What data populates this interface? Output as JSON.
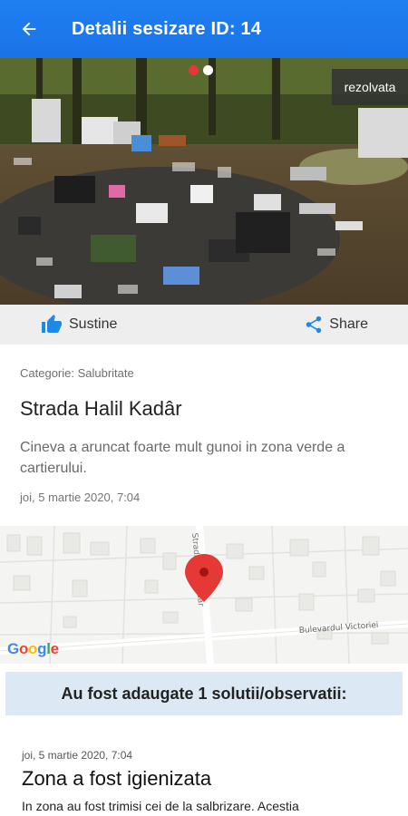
{
  "appbar": {
    "title": "Detalii sesizare ID: 14",
    "back_icon": "arrow-back-icon",
    "color": "#1a73e8"
  },
  "hero": {
    "status": "rezolvata",
    "photo_index": 1,
    "photo_count": 2
  },
  "actions": {
    "support_label": "Sustine",
    "share_label": "Share",
    "accent": "#1e88e5"
  },
  "report": {
    "category": "Categorie: Salubritate",
    "street": "Strada Halil Kadâr",
    "description": "Cineva a aruncat foarte mult gunoi in zona verde a cartierului.",
    "date": "joi, 5 martie 2020, 7:04"
  },
  "map": {
    "street_label_1": "Strada Halil Kadâr",
    "street_label_2": "Bulevardul Victoriei",
    "provider": "Google"
  },
  "solutions": {
    "header": "Au fost adaugate 1 solutii/observatii:",
    "items": [
      {
        "date": "joi, 5 martie 2020, 7:04",
        "title": "Zona a fost igienizata",
        "text": "In zona au fost trimisi cei de la salbrizare. Acestia"
      }
    ]
  }
}
